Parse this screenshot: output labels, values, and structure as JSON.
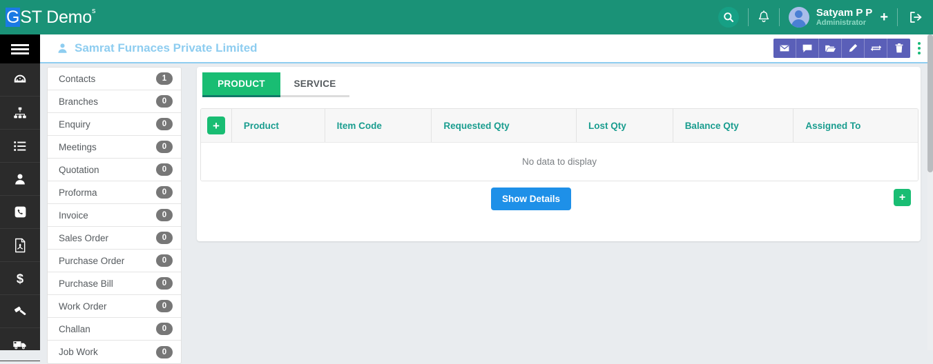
{
  "topbar": {
    "brand_prefix": "G",
    "brand_rest": "ST Demo",
    "brand_sup": "s",
    "search_icon": "search-icon",
    "bell_icon": "bell-icon",
    "user_name": "Satyam P P",
    "user_role": "Administrator",
    "plus_label": "+",
    "logout_icon": "logout-icon",
    "brand_bg": "#1a9277",
    "g_box_bg": "#1a7ae4"
  },
  "rail": {
    "toggle_icon": "hamburger-icon",
    "items": [
      {
        "icon": "dashboard-icon"
      },
      {
        "icon": "sitemap-icon"
      },
      {
        "icon": "list-icon"
      },
      {
        "icon": "user-icon"
      },
      {
        "icon": "phone-icon"
      },
      {
        "icon": "pdf-file-icon"
      },
      {
        "icon": "dollar-icon"
      },
      {
        "icon": "gavel-icon"
      },
      {
        "icon": "truck-icon"
      }
    ]
  },
  "page_header": {
    "person_icon": "person-icon",
    "company_title": "Samrat Furnaces Private Limited",
    "title_color": "#8ecdf0",
    "actions": [
      {
        "icon": "envelope-icon",
        "name": "email-button"
      },
      {
        "icon": "comment-icon",
        "name": "comment-button"
      },
      {
        "icon": "folder-open-icon",
        "name": "folder-button"
      },
      {
        "icon": "pencil-icon",
        "name": "edit-button"
      },
      {
        "icon": "exchange-icon",
        "name": "convert-button"
      },
      {
        "icon": "trash-icon",
        "name": "delete-button"
      }
    ],
    "kebab_icon": "kebab-menu-icon",
    "action_bar_bg": "#5a5fb8"
  },
  "list_panel": {
    "items": [
      {
        "label": "Contacts",
        "count": "1"
      },
      {
        "label": "Branches",
        "count": "0"
      },
      {
        "label": "Enquiry",
        "count": "0"
      },
      {
        "label": "Meetings",
        "count": "0"
      },
      {
        "label": "Quotation",
        "count": "0"
      },
      {
        "label": "Proforma",
        "count": "0"
      },
      {
        "label": "Invoice",
        "count": "0"
      },
      {
        "label": "Sales Order",
        "count": "0"
      },
      {
        "label": "Purchase Order",
        "count": "0"
      },
      {
        "label": "Purchase Bill",
        "count": "0"
      },
      {
        "label": "Work Order",
        "count": "0"
      },
      {
        "label": "Challan",
        "count": "0"
      },
      {
        "label": "Job Work",
        "count": "0"
      }
    ]
  },
  "content": {
    "tabs": [
      {
        "label": "PRODUCT",
        "active": true
      },
      {
        "label": "SERVICE",
        "active": false
      }
    ],
    "active_tab_bg": "#19bd73",
    "table": {
      "add_button_label": "+",
      "columns": [
        "Product",
        "Item Code",
        "Requested Qty",
        "Lost Qty",
        "Balance Qty",
        "Assigned To"
      ],
      "empty_message": "No data to display",
      "rows": []
    },
    "show_details_label": "Show Details",
    "show_details_color": "#1e90e8",
    "fab_add_label": "+"
  }
}
